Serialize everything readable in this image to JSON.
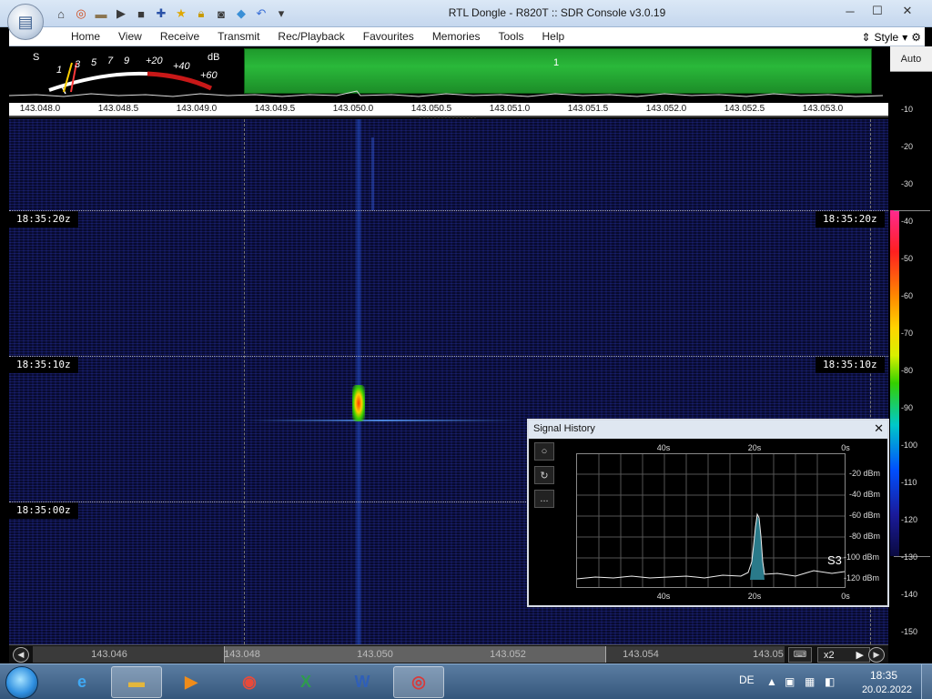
{
  "window": {
    "title": "RTL Dongle - R820T :: SDR Console v3.0.19",
    "minimize": "─",
    "maximize": "☐",
    "close": "✕"
  },
  "quick_access": [
    "home-icon",
    "help-ring-icon",
    "folder-icon",
    "play-icon",
    "stop-icon",
    "plus-icon",
    "star-icon",
    "lock-icon",
    "camera-icon",
    "drop-icon",
    "undo-icon",
    "dropdown-icon"
  ],
  "menu": {
    "items": [
      "Home",
      "View",
      "Receive",
      "Transmit",
      "Rec/Playback",
      "Favourites",
      "Memories",
      "Tools",
      "Help"
    ],
    "style_label": "Style"
  },
  "smeter": {
    "s_label": "S",
    "db_label": "dB",
    "scale": [
      "1",
      "3",
      "5",
      "7",
      "9",
      "+20",
      "+40",
      "+60"
    ]
  },
  "panorama": {
    "marker": "1"
  },
  "frequency_ruler": [
    "143.048.0",
    "143.048.5",
    "143.049.0",
    "143.049.5",
    "143.050.0",
    "143.050.5",
    "143.051.0",
    "143.051.5",
    "143.052.0",
    "143.052.5",
    "143.053.0"
  ],
  "waterfall": {
    "time_tags": [
      "18:35:20z",
      "18:35:10z",
      "18:35:00z"
    ]
  },
  "color_scale": {
    "auto_label": "Auto",
    "ticks": [
      "-10",
      "-20",
      "-30",
      "-40",
      "-50",
      "-60",
      "-70",
      "-80",
      "-90",
      "-100",
      "-110",
      "-120",
      "-130",
      "-140",
      "-150"
    ]
  },
  "signal_history": {
    "title": "Signal History",
    "close": "✕",
    "tools": [
      "○",
      "↻",
      "..."
    ],
    "x_top": [
      "40s",
      "20s",
      "0s"
    ],
    "x_bottom": [
      "40s",
      "20s",
      "0s"
    ],
    "y_labels": [
      "-20 dBm",
      "-40 dBm",
      "-60 dBm",
      "-80 dBm",
      "-100 dBm",
      "-120 dBm"
    ],
    "s_value": "S3"
  },
  "bottom_bar": {
    "labels": [
      "143.046",
      "143.048",
      "143.050",
      "143.052",
      "143.054",
      "143.05"
    ],
    "zoom": "x2",
    "zoom_arrow": "▶"
  },
  "taskbar": {
    "language": "DE",
    "time": "18:35",
    "date": "20.02.2022"
  }
}
